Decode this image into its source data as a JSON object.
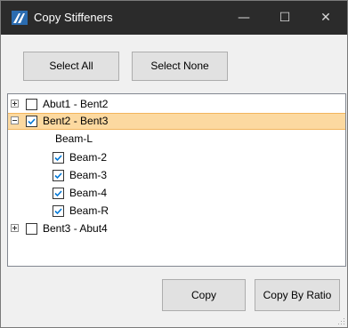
{
  "window": {
    "title": "Copy Stiffeners",
    "minimize_glyph": "—",
    "maximize_glyph": "☐",
    "close_glyph": "✕",
    "icon": "app-logo-icon"
  },
  "toolbar": {
    "select_all_label": "Select All",
    "select_none_label": "Select None"
  },
  "tree": {
    "nodes": [
      {
        "label": "Abut1 - Bent2",
        "expander": "plus",
        "checked": false
      },
      {
        "label": "Bent2 - Bent3",
        "expander": "minus",
        "checked": true,
        "selected": true
      },
      {
        "label": "Beam-L",
        "checkbox": false
      },
      {
        "label": "Beam-2",
        "checked": true
      },
      {
        "label": "Beam-3",
        "checked": true
      },
      {
        "label": "Beam-4",
        "checked": true
      },
      {
        "label": "Beam-R",
        "checked": true
      },
      {
        "label": "Bent3 - Abut4",
        "expander": "plus",
        "checked": false
      }
    ]
  },
  "actions": {
    "copy_label": "Copy",
    "copy_by_ratio_label": "Copy By Ratio"
  },
  "colors": {
    "titlebar": "#2b2b2b",
    "selection": "#fcd9a0",
    "check": "#0078d7"
  }
}
